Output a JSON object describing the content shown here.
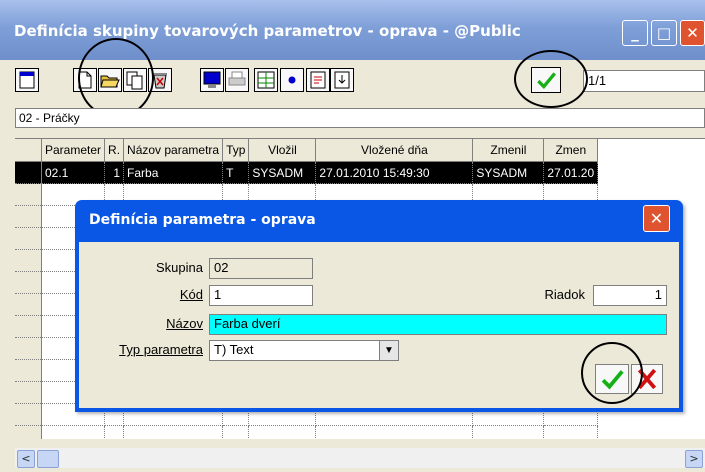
{
  "window": {
    "title": "Definícia skupiny tovarových parametrov - oprava - @Public"
  },
  "toolbar": {
    "buttons": [
      "new-doc-icon",
      "new-page-icon",
      "open-folder-icon",
      "copy-icon",
      "delete-icon",
      "screen-icon",
      "print-icon",
      "columns-icon",
      "dot-icon",
      "report-icon",
      "export-icon"
    ],
    "record_indicator": "1/1"
  },
  "path_field": "02 - Práčky",
  "grid": {
    "columns": [
      "Parameter",
      "R.",
      "Názov parametra",
      "Typ",
      "Vložil",
      "Vložené dňa",
      "Zmenil",
      "Zmen"
    ],
    "rows": [
      [
        "02.1",
        "1",
        "Farba",
        "T",
        "SYSADM",
        "27.01.2010 15:49:30",
        "SYSADM",
        "27.01.20"
      ]
    ]
  },
  "dialog": {
    "title": "Definícia parametra - oprava",
    "fields": {
      "skupina_label": "Skupina",
      "skupina_value": "02",
      "kod_label": "Kód",
      "kod_value": "1",
      "riadok_label": "Riadok",
      "riadok_value": "1",
      "nazov_label": "Názov",
      "nazov_value": "Farba dverí",
      "typ_label": "Typ parametra",
      "typ_value": "T) Text"
    }
  },
  "colors": {
    "titlebar": "#7f9fd8",
    "dialog_title": "#0a57e6",
    "highlight": "#00ffff",
    "selected_row": "#000000"
  }
}
